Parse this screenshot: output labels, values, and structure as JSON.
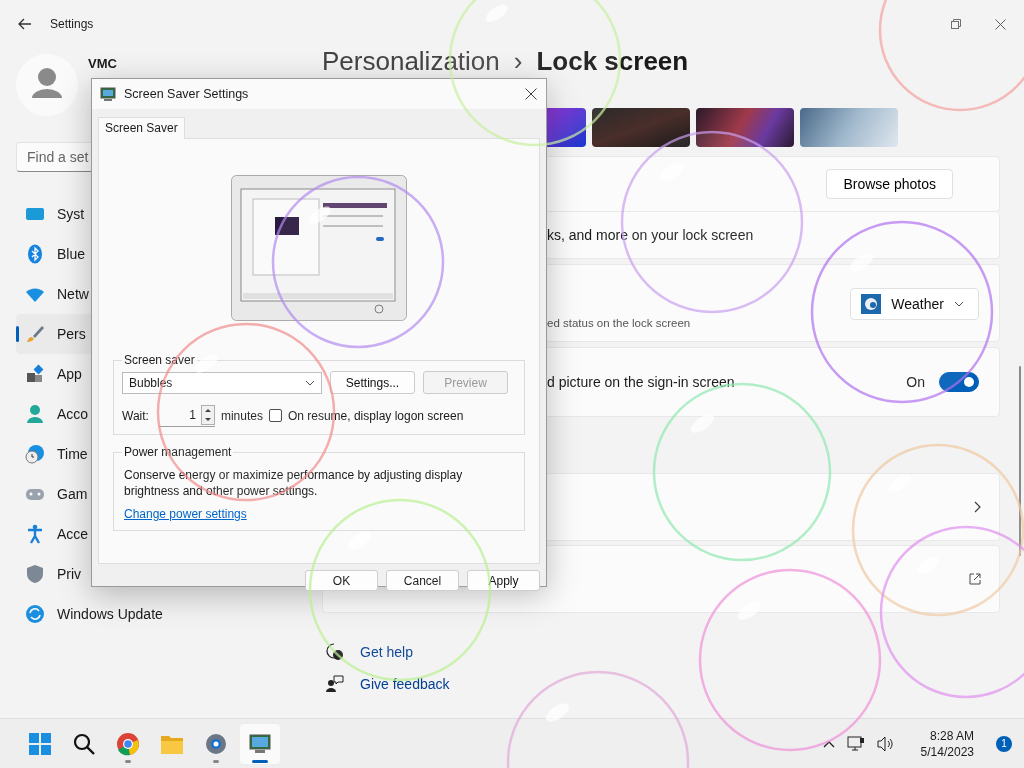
{
  "settings_window": {
    "title": "Settings"
  },
  "user": {
    "name": "VMC"
  },
  "search": {
    "placeholder": "Find a set"
  },
  "nav": [
    {
      "label": "Syst",
      "kind": "system",
      "selected": false
    },
    {
      "label": "Blue",
      "kind": "bluetooth",
      "selected": false
    },
    {
      "label": "Netw",
      "kind": "network",
      "selected": false
    },
    {
      "label": "Pers",
      "kind": "personalization",
      "selected": true
    },
    {
      "label": "App",
      "kind": "apps",
      "selected": false
    },
    {
      "label": "Acco",
      "kind": "accounts",
      "selected": false
    },
    {
      "label": "Time",
      "kind": "time",
      "selected": false
    },
    {
      "label": "Gam",
      "kind": "gaming",
      "selected": false
    },
    {
      "label": "Acce",
      "kind": "accessibility",
      "selected": false
    },
    {
      "label": "Priv",
      "kind": "privacy",
      "selected": false
    },
    {
      "label": "Windows Update",
      "kind": "update",
      "selected": false
    }
  ],
  "breadcrumb": {
    "parent": "Personalization",
    "separator": "›",
    "current": "Lock screen"
  },
  "lock_screen": {
    "browse_button": "Browse photos",
    "status_text": "ks, and more on your lock screen",
    "status_desc": "ed status on the lock screen",
    "status_app": "Weather",
    "signin_text": "d picture on the sign-in screen",
    "signin_state": "On",
    "signin_on": true
  },
  "rows": [
    {
      "kind": "chevron"
    },
    {
      "kind": "external"
    }
  ],
  "links": [
    {
      "kind": "help",
      "label": "Get help"
    },
    {
      "kind": "feedback",
      "label": "Give feedback"
    }
  ],
  "dialog": {
    "title": "Screen Saver Settings",
    "tabs": [
      {
        "label": "Screen Saver",
        "selected": true
      }
    ],
    "screen_saver": {
      "legend": "Screen saver",
      "value": "Bubbles",
      "settings_button": "Settings...",
      "preview_button": {
        "label": "Preview",
        "disabled": true
      },
      "wait_label": "Wait:",
      "wait_value": "1",
      "wait_unit": "minutes",
      "logon_checkbox": {
        "label": "On resume, display logon screen",
        "checked": false
      }
    },
    "power": {
      "legend": "Power management",
      "text": "Conserve energy or maximize performance by adjusting display brightness and other power settings.",
      "link": "Change power settings"
    },
    "buttons": [
      "OK",
      "Cancel",
      "Apply"
    ]
  },
  "taskbar": {
    "apps": [
      {
        "kind": "start",
        "running": false,
        "selected": false
      },
      {
        "kind": "search",
        "running": false,
        "selected": false
      },
      {
        "kind": "browser",
        "running": true,
        "selected": false
      },
      {
        "kind": "folder",
        "running": false,
        "selected": false
      },
      {
        "kind": "settings",
        "running": true,
        "selected": false
      },
      {
        "kind": "screensaver",
        "running": true,
        "selected": true
      }
    ],
    "time": "8:28 AM",
    "date": "5/14/2023",
    "notifications": "1"
  }
}
